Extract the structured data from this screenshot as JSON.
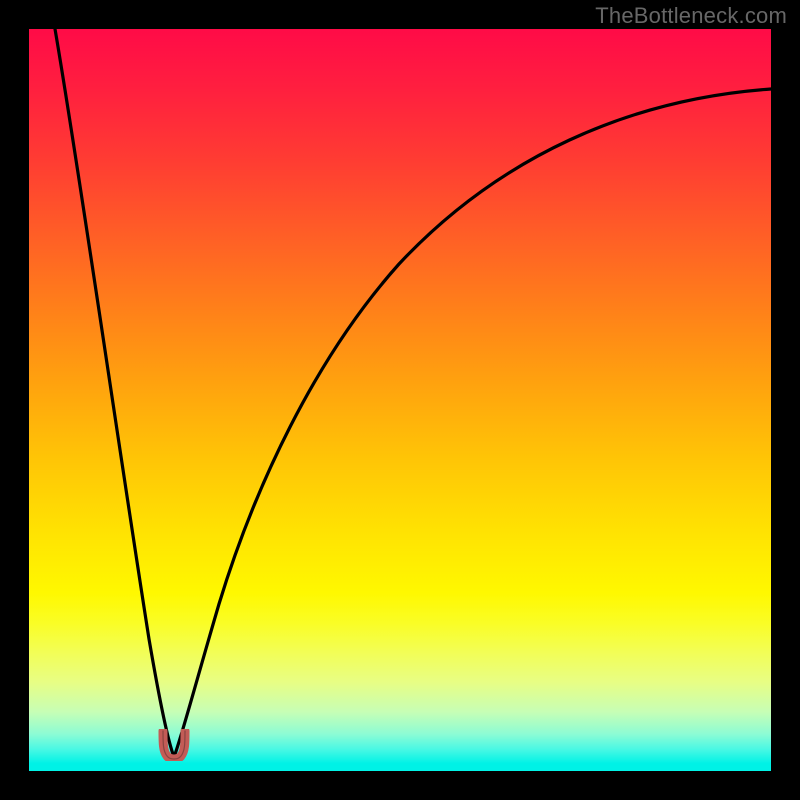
{
  "watermark": {
    "text": "TheBottleneck.com"
  },
  "colors": {
    "page_bg": "#000000",
    "curve_stroke": "#000000",
    "marker_fill": "#c35b56",
    "marker_stroke": "#1e1a19"
  },
  "chart_data": {
    "type": "line",
    "title": "",
    "xlabel": "",
    "ylabel": "",
    "xlim": [
      0,
      100
    ],
    "ylim": [
      0,
      100
    ],
    "grid": false,
    "legend": false,
    "series": [
      {
        "name": "bottleneck-left",
        "x": [
          3.5,
          5,
          7,
          9,
          11,
          13,
          15,
          17,
          18.7,
          19.5
        ],
        "y": [
          100,
          88,
          72,
          57,
          43,
          30,
          18,
          8,
          2,
          0.4
        ]
      },
      {
        "name": "bottleneck-right",
        "x": [
          19.5,
          21,
          23,
          26,
          30,
          35,
          41,
          48,
          56,
          65,
          75,
          86,
          98,
          100
        ],
        "y": [
          0.4,
          3,
          10,
          21,
          33,
          45,
          56,
          65,
          73,
          79,
          84,
          88,
          91,
          92
        ]
      }
    ],
    "annotations": [
      {
        "name": "optimal-marker",
        "x": 19.5,
        "y": 1.5
      }
    ]
  }
}
